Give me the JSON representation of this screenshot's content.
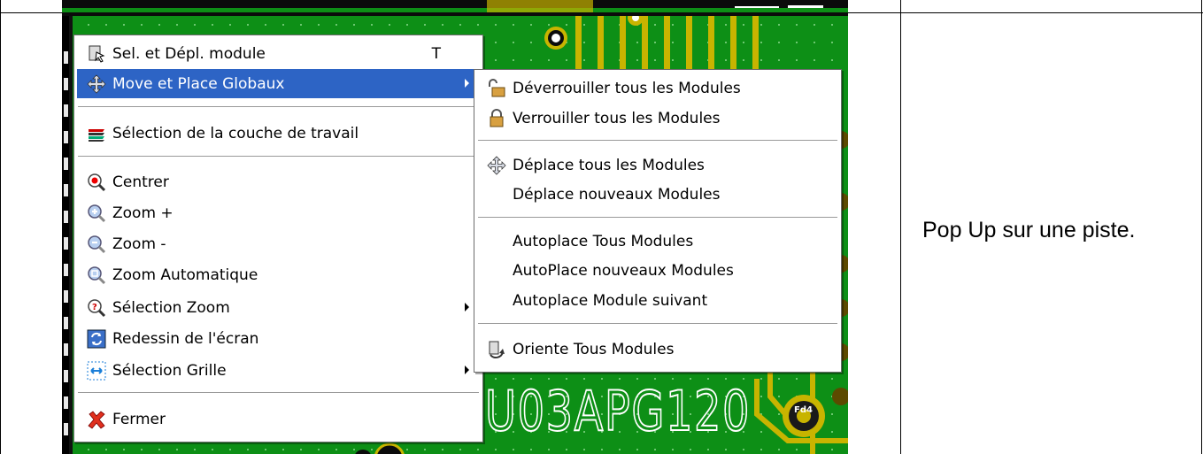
{
  "caption": "Pop Up sur une piste.",
  "board_silkscreen_text": "U03APG120",
  "pad_label": "Fd4",
  "context_menu": {
    "items": [
      {
        "label": "Sel. et Dépl. module",
        "shortcut": "T",
        "icon": "module-select-icon"
      },
      {
        "label": "Move et Place Globaux",
        "icon": "move-cross-icon",
        "highlighted": true,
        "submenu": true
      },
      {
        "label": "Sélection de la couche de travail",
        "icon": "layers-icon"
      },
      {
        "label": "Centrer",
        "icon": "center-zoom-icon"
      },
      {
        "label": "Zoom +",
        "icon": "zoom-in-icon"
      },
      {
        "label": "Zoom -",
        "icon": "zoom-out-icon"
      },
      {
        "label": "Zoom Automatique",
        "icon": "zoom-auto-icon"
      },
      {
        "label": "Sélection Zoom",
        "icon": "zoom-select-icon",
        "submenu": true
      },
      {
        "label": "Redessin de l'écran",
        "icon": "redraw-icon"
      },
      {
        "label": "Sélection Grille",
        "icon": "grid-icon",
        "submenu": true
      },
      {
        "label": "Fermer",
        "icon": "close-x-icon"
      }
    ]
  },
  "submenu": {
    "items": [
      {
        "label": "Déverrouiller tous les Modules",
        "icon": "unlock-icon"
      },
      {
        "label": "Verrouiller tous les Modules",
        "icon": "lock-icon"
      },
      {
        "label": "Déplace tous les Modules",
        "icon": "move-cross-icon"
      },
      {
        "label": "Déplace nouveaux Modules"
      },
      {
        "label": "Autoplace Tous Modules"
      },
      {
        "label": "AutoPlace nouveaux Modules"
      },
      {
        "label": "Autoplace Module suivant"
      },
      {
        "label": "Oriente Tous Modules",
        "icon": "orient-icon"
      }
    ]
  },
  "colors": {
    "board_green": "#0d8f16",
    "track_yellow": "#c8b400",
    "menu_highlight": "#2d64c5"
  }
}
